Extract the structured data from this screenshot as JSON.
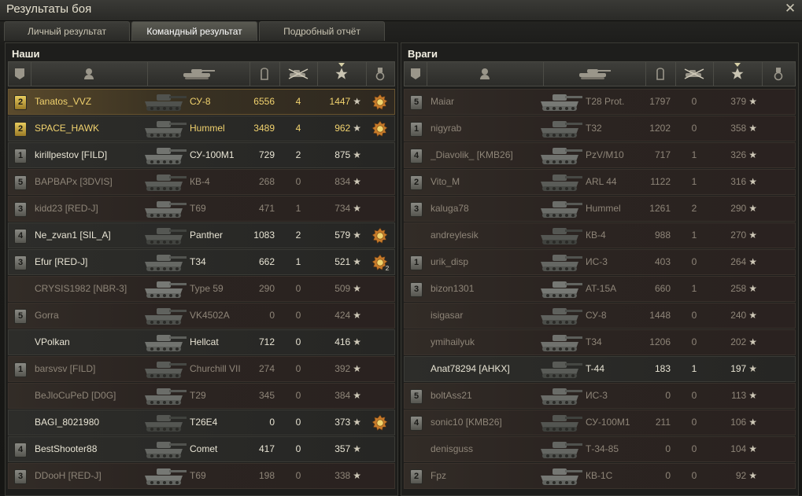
{
  "window": {
    "title": "Результаты боя",
    "close_icon": "close-icon"
  },
  "tabs": [
    {
      "label": "Личный результат",
      "active": false
    },
    {
      "label": "Командный результат",
      "active": true
    },
    {
      "label": "Подробный отчёт",
      "active": false
    }
  ],
  "colors": {
    "platoon": "#f1d26e",
    "dead_text": "#8e8578",
    "alive_text": "#e8e4d4",
    "mine_row": "#5a4a2c"
  },
  "allies": {
    "title": "Наши",
    "columns": [
      "squad-icon",
      "player-icon",
      "tank-icon",
      "damage-icon",
      "kills-icon",
      "experience-star-icon",
      "medal-icon"
    ],
    "rows": [
      {
        "badge": "2",
        "badge_gold": true,
        "name": "Tanatos_VVZ",
        "tank": "СУ-8",
        "damage": "6556",
        "kills": "4",
        "xp": "1447",
        "medal": true,
        "medal_count": "",
        "state": "mine",
        "platoon": true
      },
      {
        "badge": "2",
        "badge_gold": true,
        "name": "SPACE_HAWK",
        "tank": "Hummel",
        "damage": "3489",
        "kills": "4",
        "xp": "962",
        "medal": true,
        "medal_count": "",
        "state": "alive",
        "platoon": true
      },
      {
        "badge": "1",
        "badge_gold": false,
        "name": "kirillpestov [FILD]",
        "tank": "СУ-100М1",
        "damage": "729",
        "kills": "2",
        "xp": "875",
        "medal": false,
        "medal_count": "",
        "state": "alive",
        "platoon": false
      },
      {
        "badge": "5",
        "badge_gold": false,
        "name": "BAPBAPx [3DVIS]",
        "tank": "КВ-4",
        "damage": "268",
        "kills": "0",
        "xp": "834",
        "medal": false,
        "medal_count": "",
        "state": "dead",
        "platoon": false
      },
      {
        "badge": "3",
        "badge_gold": false,
        "name": "kidd23 [RED-J]",
        "tank": "T69",
        "damage": "471",
        "kills": "1",
        "xp": "734",
        "medal": false,
        "medal_count": "",
        "state": "dead",
        "platoon": false
      },
      {
        "badge": "4",
        "badge_gold": false,
        "name": "Ne_zvan1 [SIL_A]",
        "tank": "Panther",
        "damage": "1083",
        "kills": "2",
        "xp": "579",
        "medal": true,
        "medal_count": "",
        "state": "alive",
        "platoon": false
      },
      {
        "badge": "3",
        "badge_gold": false,
        "name": "Efur [RED-J]",
        "tank": "T34",
        "damage": "662",
        "kills": "1",
        "xp": "521",
        "medal": true,
        "medal_count": "2",
        "state": "alive",
        "platoon": false
      },
      {
        "badge": "",
        "badge_gold": false,
        "name": "CRYSIS1982 [NBR-3]",
        "tank": "Type 59",
        "damage": "290",
        "kills": "0",
        "xp": "509",
        "medal": false,
        "medal_count": "",
        "state": "dead",
        "platoon": false
      },
      {
        "badge": "5",
        "badge_gold": false,
        "name": "Gorra",
        "tank": "VK4502A",
        "damage": "0",
        "kills": "0",
        "xp": "424",
        "medal": false,
        "medal_count": "",
        "state": "dead",
        "platoon": false
      },
      {
        "badge": "",
        "badge_gold": false,
        "name": "VPolkan",
        "tank": "Hellcat",
        "damage": "712",
        "kills": "0",
        "xp": "416",
        "medal": false,
        "medal_count": "",
        "state": "alive",
        "platoon": false
      },
      {
        "badge": "1",
        "badge_gold": false,
        "name": "barsvsv [FILD]",
        "tank": "Churchill VII",
        "damage": "274",
        "kills": "0",
        "xp": "392",
        "medal": false,
        "medal_count": "",
        "state": "dead",
        "platoon": false
      },
      {
        "badge": "",
        "badge_gold": false,
        "name": "BeJloCuPeD [D0G]",
        "tank": "T29",
        "damage": "345",
        "kills": "0",
        "xp": "384",
        "medal": false,
        "medal_count": "",
        "state": "dead",
        "platoon": false
      },
      {
        "badge": "",
        "badge_gold": false,
        "name": "BAGI_8021980",
        "tank": "T26E4",
        "damage": "0",
        "kills": "0",
        "xp": "373",
        "medal": true,
        "medal_count": "",
        "state": "alive",
        "platoon": false
      },
      {
        "badge": "4",
        "badge_gold": false,
        "name": "BestShooter88",
        "tank": "Comet",
        "damage": "417",
        "kills": "0",
        "xp": "357",
        "medal": false,
        "medal_count": "",
        "state": "alive",
        "platoon": false
      },
      {
        "badge": "3",
        "badge_gold": false,
        "name": "DDooH [RED-J]",
        "tank": "T69",
        "damage": "198",
        "kills": "0",
        "xp": "338",
        "medal": false,
        "medal_count": "",
        "state": "dead",
        "platoon": false
      }
    ]
  },
  "enemies": {
    "title": "Враги",
    "columns": [
      "squad-icon",
      "player-icon",
      "tank-icon",
      "damage-icon",
      "kills-icon",
      "experience-star-icon",
      "medal-icon"
    ],
    "rows": [
      {
        "badge": "5",
        "name": "Maiar",
        "tank": "T28 Prot.",
        "damage": "1797",
        "kills": "0",
        "xp": "379",
        "state": "dead"
      },
      {
        "badge": "1",
        "name": "nigyrab",
        "tank": "T32",
        "damage": "1202",
        "kills": "0",
        "xp": "358",
        "state": "dead"
      },
      {
        "badge": "4",
        "name": "_Diavolik_ [KMB26]",
        "tank": "PzV/M10",
        "damage": "717",
        "kills": "1",
        "xp": "326",
        "state": "dead"
      },
      {
        "badge": "2",
        "name": "Vito_M",
        "tank": "ARL 44",
        "damage": "1122",
        "kills": "1",
        "xp": "316",
        "state": "dead"
      },
      {
        "badge": "3",
        "name": "kaluga78",
        "tank": "Hummel",
        "damage": "1261",
        "kills": "2",
        "xp": "290",
        "state": "dead"
      },
      {
        "badge": "",
        "name": "andreylesik",
        "tank": "КВ-4",
        "damage": "988",
        "kills": "1",
        "xp": "270",
        "state": "dead"
      },
      {
        "badge": "1",
        "name": "urik_disp",
        "tank": "ИС-3",
        "damage": "403",
        "kills": "0",
        "xp": "264",
        "state": "dead"
      },
      {
        "badge": "3",
        "name": "bizon1301",
        "tank": "AT-15A",
        "damage": "660",
        "kills": "1",
        "xp": "258",
        "state": "dead"
      },
      {
        "badge": "",
        "name": "isigasar",
        "tank": "СУ-8",
        "damage": "1448",
        "kills": "0",
        "xp": "240",
        "state": "dead"
      },
      {
        "badge": "",
        "name": "ymihailyuk",
        "tank": "T34",
        "damage": "1206",
        "kills": "0",
        "xp": "202",
        "state": "dead"
      },
      {
        "badge": "",
        "name": "Anat78294 [AHKX]",
        "tank": "T-44",
        "damage": "183",
        "kills": "1",
        "xp": "197",
        "state": "alive"
      },
      {
        "badge": "5",
        "name": "boltAss21",
        "tank": "ИС-3",
        "damage": "0",
        "kills": "0",
        "xp": "113",
        "state": "dead"
      },
      {
        "badge": "4",
        "name": "sonic10 [KMB26]",
        "tank": "СУ-100М1",
        "damage": "211",
        "kills": "0",
        "xp": "106",
        "state": "dead"
      },
      {
        "badge": "",
        "name": "denisguss",
        "tank": "Т-34-85",
        "damage": "0",
        "kills": "0",
        "xp": "104",
        "state": "dead"
      },
      {
        "badge": "2",
        "name": "Fpz",
        "tank": "КВ-1С",
        "damage": "0",
        "kills": "0",
        "xp": "92",
        "state": "dead"
      }
    ]
  }
}
